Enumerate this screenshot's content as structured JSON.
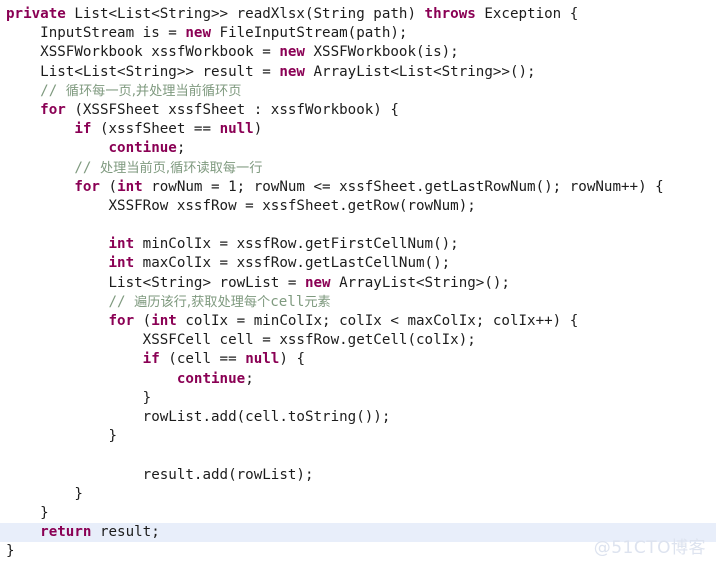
{
  "editor": {
    "language": "java",
    "background_color": "#ffffff",
    "text_color": "#1c1c1c",
    "keyword_color": "#8a0054",
    "comment_color": "#7f9a7f",
    "highlight_color": "#e8eefa",
    "watermark": "@51CTO博客",
    "watermark_color": "#dde3ef",
    "lines": [
      {
        "indent": 0,
        "highlighted": false,
        "tokens": [
          {
            "t": "private",
            "k": "kw"
          },
          {
            "t": " List<List<String>> readXlsx(String path) ",
            "k": "plain"
          },
          {
            "t": "throws",
            "k": "kw"
          },
          {
            "t": " Exception {",
            "k": "plain"
          }
        ]
      },
      {
        "indent": 1,
        "highlighted": false,
        "tokens": [
          {
            "t": "InputStream is = ",
            "k": "plain"
          },
          {
            "t": "new",
            "k": "kw"
          },
          {
            "t": " FileInputStream(path);",
            "k": "plain"
          }
        ]
      },
      {
        "indent": 1,
        "highlighted": false,
        "tokens": [
          {
            "t": "XSSFWorkbook xssfWorkbook = ",
            "k": "plain"
          },
          {
            "t": "new",
            "k": "kw"
          },
          {
            "t": " XSSFWorkbook(is);",
            "k": "plain"
          }
        ]
      },
      {
        "indent": 1,
        "highlighted": false,
        "tokens": [
          {
            "t": "List<List<String>> result = ",
            "k": "plain"
          },
          {
            "t": "new",
            "k": "kw"
          },
          {
            "t": " ArrayList<List<String>>();",
            "k": "plain"
          }
        ]
      },
      {
        "indent": 1,
        "highlighted": false,
        "tokens": [
          {
            "t": "// ",
            "k": "cmt"
          },
          {
            "t": "循环每一页,并处理当前循环页",
            "k": "cmt-cn"
          }
        ]
      },
      {
        "indent": 1,
        "highlighted": false,
        "tokens": [
          {
            "t": "for",
            "k": "kw"
          },
          {
            "t": " (XSSFSheet xssfSheet : xssfWorkbook) {",
            "k": "plain"
          }
        ]
      },
      {
        "indent": 2,
        "highlighted": false,
        "tokens": [
          {
            "t": "if",
            "k": "kw"
          },
          {
            "t": " (xssfSheet == ",
            "k": "plain"
          },
          {
            "t": "null",
            "k": "kw"
          },
          {
            "t": ")",
            "k": "plain"
          }
        ]
      },
      {
        "indent": 3,
        "highlighted": false,
        "tokens": [
          {
            "t": "continue",
            "k": "kw"
          },
          {
            "t": ";",
            "k": "plain"
          }
        ]
      },
      {
        "indent": 2,
        "highlighted": false,
        "tokens": [
          {
            "t": "// ",
            "k": "cmt"
          },
          {
            "t": "处理当前页,循环读取每一行",
            "k": "cmt-cn"
          }
        ]
      },
      {
        "indent": 2,
        "highlighted": false,
        "tokens": [
          {
            "t": "for",
            "k": "kw"
          },
          {
            "t": " (",
            "k": "plain"
          },
          {
            "t": "int",
            "k": "kw"
          },
          {
            "t": " rowNum = 1; rowNum <= xssfSheet.getLastRowNum(); rowNum++) {",
            "k": "plain"
          }
        ]
      },
      {
        "indent": 3,
        "highlighted": false,
        "tokens": [
          {
            "t": "XSSFRow xssfRow = xssfSheet.getRow(rowNum);",
            "k": "plain"
          }
        ]
      },
      {
        "indent": 0,
        "highlighted": false,
        "tokens": []
      },
      {
        "indent": 3,
        "highlighted": false,
        "tokens": [
          {
            "t": "int",
            "k": "kw"
          },
          {
            "t": " minColIx = xssfRow.getFirstCellNum();",
            "k": "plain"
          }
        ]
      },
      {
        "indent": 3,
        "highlighted": false,
        "tokens": [
          {
            "t": "int",
            "k": "kw"
          },
          {
            "t": " maxColIx = xssfRow.getLastCellNum();",
            "k": "plain"
          }
        ]
      },
      {
        "indent": 3,
        "highlighted": false,
        "tokens": [
          {
            "t": "List<String> rowList = ",
            "k": "plain"
          },
          {
            "t": "new",
            "k": "kw"
          },
          {
            "t": " ArrayList<String>();",
            "k": "plain"
          }
        ]
      },
      {
        "indent": 3,
        "highlighted": false,
        "tokens": [
          {
            "t": "// ",
            "k": "cmt"
          },
          {
            "t": "遍历该行,获取处理每个",
            "k": "cmt-cn"
          },
          {
            "t": "cell",
            "k": "cmt"
          },
          {
            "t": "元素",
            "k": "cmt-cn"
          }
        ]
      },
      {
        "indent": 3,
        "highlighted": false,
        "tokens": [
          {
            "t": "for",
            "k": "kw"
          },
          {
            "t": " (",
            "k": "plain"
          },
          {
            "t": "int",
            "k": "kw"
          },
          {
            "t": " colIx = minColIx; colIx < maxColIx; colIx++) {",
            "k": "plain"
          }
        ]
      },
      {
        "indent": 4,
        "highlighted": false,
        "tokens": [
          {
            "t": "XSSFCell cell = xssfRow.getCell(colIx);",
            "k": "plain"
          }
        ]
      },
      {
        "indent": 4,
        "highlighted": false,
        "tokens": [
          {
            "t": "if",
            "k": "kw"
          },
          {
            "t": " (cell == ",
            "k": "plain"
          },
          {
            "t": "null",
            "k": "kw"
          },
          {
            "t": ") {",
            "k": "plain"
          }
        ]
      },
      {
        "indent": 5,
        "highlighted": false,
        "tokens": [
          {
            "t": "continue",
            "k": "kw"
          },
          {
            "t": ";",
            "k": "plain"
          }
        ]
      },
      {
        "indent": 4,
        "highlighted": false,
        "tokens": [
          {
            "t": "}",
            "k": "plain"
          }
        ]
      },
      {
        "indent": 4,
        "highlighted": false,
        "tokens": [
          {
            "t": "rowList.add(cell.toString());",
            "k": "plain"
          }
        ]
      },
      {
        "indent": 3,
        "highlighted": false,
        "tokens": [
          {
            "t": "}",
            "k": "plain"
          }
        ]
      },
      {
        "indent": 0,
        "highlighted": false,
        "tokens": []
      },
      {
        "indent": 4,
        "highlighted": false,
        "tokens": [
          {
            "t": "result.add(rowList);",
            "k": "plain"
          }
        ]
      },
      {
        "indent": 2,
        "highlighted": false,
        "tokens": [
          {
            "t": "}",
            "k": "plain"
          }
        ]
      },
      {
        "indent": 1,
        "highlighted": false,
        "tokens": [
          {
            "t": "}",
            "k": "plain"
          }
        ]
      },
      {
        "indent": 1,
        "highlighted": true,
        "tokens": [
          {
            "t": "return",
            "k": "kw"
          },
          {
            "t": " result;",
            "k": "plain"
          }
        ]
      },
      {
        "indent": 0,
        "highlighted": false,
        "tokens": [
          {
            "t": "}",
            "k": "plain"
          }
        ]
      }
    ]
  }
}
